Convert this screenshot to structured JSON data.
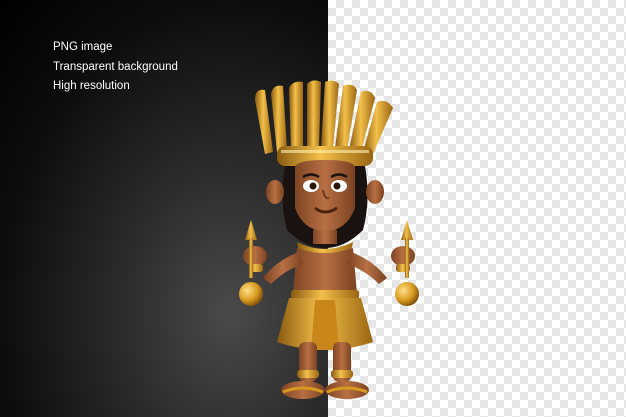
{
  "captions": [
    "PNG image",
    "Transparent background",
    "High resolution"
  ],
  "colors": {
    "panel_dark": "#000000",
    "checker_light": "#ffffff",
    "checker_dark": "#e6e6e6",
    "gold": "#d89a1e",
    "skin": "#a8633a",
    "hair": "#1a1210"
  },
  "figure": {
    "subject": "3d-cartoon-egyptian-pharaoh-character",
    "icon": "pharaoh-figure"
  }
}
